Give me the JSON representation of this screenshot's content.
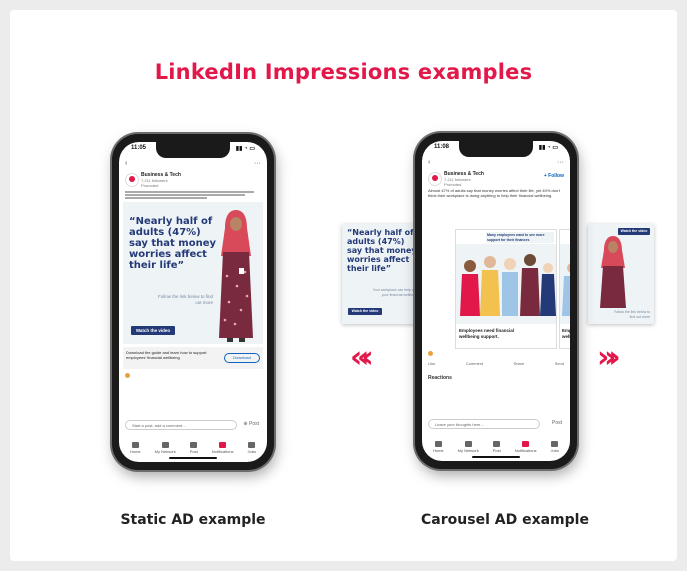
{
  "title": "LinkedIn Impressions examples",
  "colors": {
    "accent": "#e2174a",
    "navy": "#243a78"
  },
  "static_phone": {
    "time": "11:05",
    "company": "Business & Tech",
    "followers": "7,211 followers",
    "promoted": "Promoted",
    "quote": "“Nearly half of adults (47%) say that money worries affect their life”",
    "quote_sub": "Follow the link below to find out more",
    "cta": "Watch the video",
    "footer_text": "Download the guide and learn how to support employees' financial wellbeing",
    "footer_btn": "Download",
    "comment_placeholder": "Start a post, add a comment…",
    "nav": [
      "Home",
      "My Network",
      "Post",
      "Notifications",
      "Jobs"
    ]
  },
  "carousel_phone": {
    "time": "11:08",
    "company": "Business & Tech",
    "followers": "7,211 followers",
    "promoted": "Promoted",
    "follow": "+ Follow",
    "body": "Almost 47% of adults say that money worries affect their life, yet 40% don't think their workplace is doing anything to help their financial wellbeing.",
    "banner": "Many employees want to see more support for their finances",
    "card1_caption": "Employees need financial wellbeing support.",
    "card2_caption": "Employ- ee wellbe-",
    "reactions_label": "Reactions",
    "actions": [
      "Like",
      "Comment",
      "Share",
      "Send"
    ],
    "comment_placeholder": "Leave your thoughts here…",
    "post_label": "Post",
    "nav": [
      "Home",
      "My Network",
      "Post",
      "Notifications",
      "Jobs"
    ]
  },
  "left_side_card": {
    "quote": "“Nearly half of adults (47%) say that money worries affect their life”",
    "sub": "Your workplace can help with your financial wellbeing",
    "cta": "Watch the video"
  },
  "right_side_card": {
    "cta": "Watch the video",
    "sub": "Follow the link below to find out more"
  },
  "captions": {
    "static": "Static AD example",
    "carousel": "Carousel AD example"
  },
  "arrows": {
    "left": "«",
    "right": "»"
  }
}
